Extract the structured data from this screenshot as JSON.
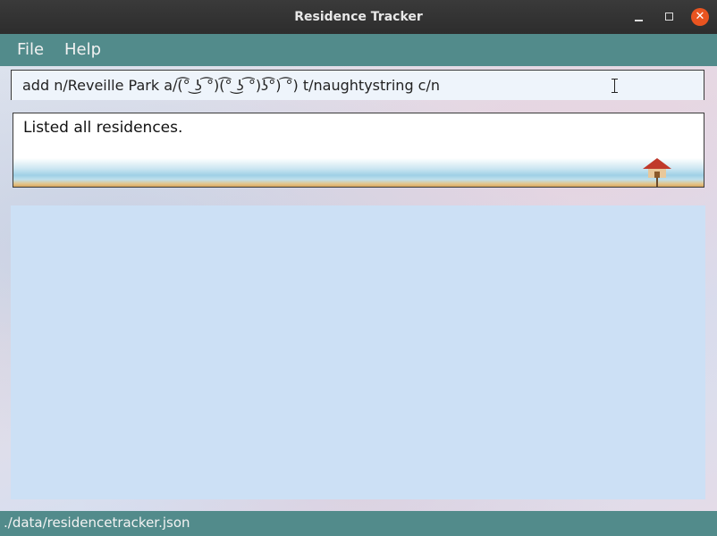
{
  "window": {
    "title": "Residence Tracker",
    "close_glyph": "✕",
    "controls": [
      "minimize-icon",
      "maximize-icon",
      "close-icon"
    ],
    "close_color": "#e95420"
  },
  "menu": {
    "items": [
      {
        "label": "File"
      },
      {
        "label": "Help"
      }
    ],
    "background_color": "#528b8b"
  },
  "command": {
    "value": "add n/Reveille Park a/(͡° ͜ʖ ͡°)(͡° ͜ʖ ͡°)ʖ͡°) ͡°) t/naughtystring c/n"
  },
  "result": {
    "message": "Listed all residences."
  },
  "residence_list": {
    "items": [],
    "background_color": "#cce0f5"
  },
  "status_bar": {
    "file_path": "./data/residencetracker.json"
  }
}
